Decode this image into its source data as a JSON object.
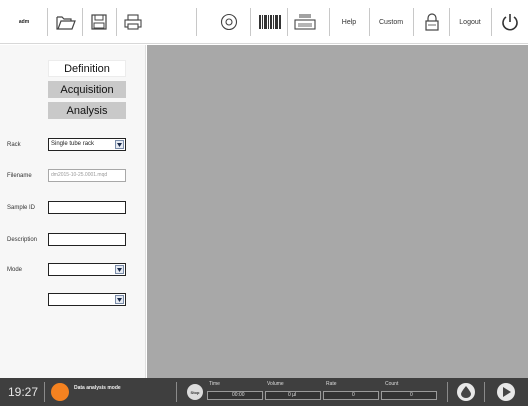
{
  "toolbar": {
    "admin_label": "adm",
    "help_label": "Help",
    "custom_label": "Custom",
    "logout_label": "Logout",
    "icons": [
      "folder-open-icon",
      "save-icon",
      "print-icon",
      "target-icon",
      "barcode-icon",
      "printer-tray-icon",
      "lock-icon",
      "power-icon"
    ]
  },
  "nav": {
    "definition": "Definition",
    "acquisition": "Acquisition",
    "analysis": "Analysis"
  },
  "form": {
    "rack_label": "Rack",
    "rack_value": "Single tube rack",
    "filename_label": "Filename",
    "filename_value": "dm2015-10-25.0001.mqd",
    "sample_id_label": "Sample ID",
    "sample_id_value": "",
    "description_label": "Description",
    "description_value": "",
    "mode_label": "Mode",
    "mode_value": "",
    "extra_select_value": ""
  },
  "status": {
    "time": "19:27",
    "mode_text": "Data analysis mode",
    "stop_label": "Stop",
    "time_label": "Time",
    "time_value": "00:00",
    "volume_label": "Volume",
    "volume_value": "0 µl",
    "rate_label": "Rate",
    "rate_value": "0",
    "count_label": "Count",
    "count_value": "0",
    "indicator_color": "#f58220"
  }
}
